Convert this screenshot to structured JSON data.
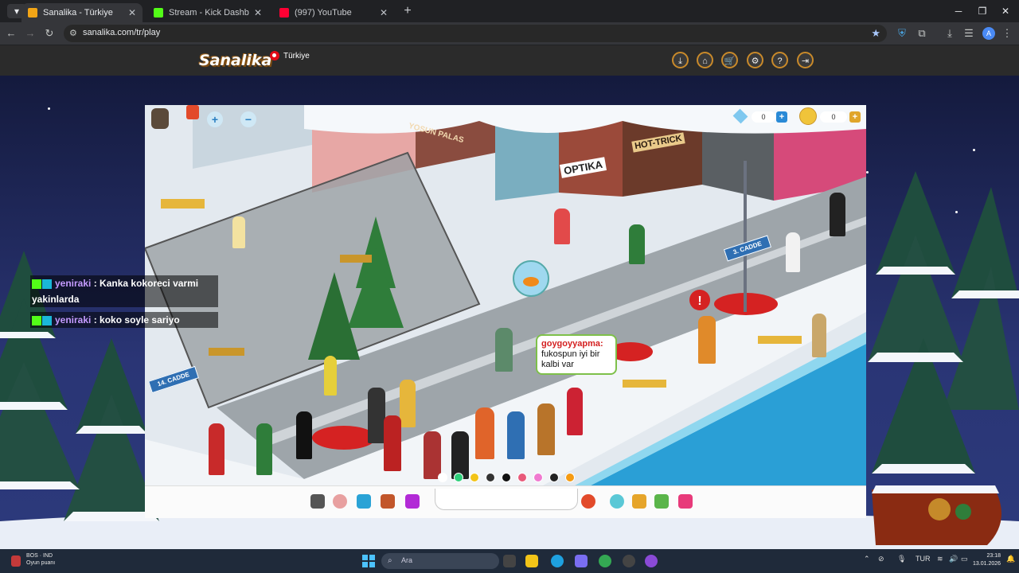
{
  "browser": {
    "tabs": [
      {
        "title": "Sanalika - Türkiye",
        "active": true,
        "favicon_color": "#f2a516"
      },
      {
        "title": "Stream - Kick Dashboard",
        "active": false,
        "favicon_color": "#53fc18"
      },
      {
        "title": "(997) YouTube",
        "active": false,
        "favicon_color": "#ff0033"
      }
    ],
    "url": "sanalika.com/tr/play",
    "profile_initial": "A"
  },
  "site": {
    "logo": "Sanalika",
    "country": "Türkiye",
    "nav_icons": [
      "download-icon",
      "home-icon",
      "cart-icon",
      "settings-icon",
      "help-icon",
      "logout-icon"
    ]
  },
  "game": {
    "diamonds": "0",
    "coins": "0",
    "signs": [
      "3. CADDE",
      "14. CADDE"
    ],
    "store_signs": [
      "YOSUN PALAS",
      "OPTIKA",
      "HOT-TRICK"
    ],
    "speech_bubble": {
      "user": "goygoyyapma:",
      "text": "fukospun iyi bir kalbi var"
    },
    "color_swatches": [
      "#ffffff",
      "#2ecf7a",
      "#f2c418",
      "#333333",
      "#111111",
      "#e85a7a",
      "#f07ad0",
      "#222222",
      "#f59b12"
    ]
  },
  "stream_chat": [
    {
      "user": "yeniraki",
      "message": ": Kanka kokoreci varmi yakinlarda"
    },
    {
      "user": "yeniraki",
      "message": ": koko soyle sariyo"
    }
  ],
  "taskbar": {
    "game_title": "BOS · IND",
    "game_subtitle": "Oyun puanı",
    "search_placeholder": "Ara",
    "language": "TUR",
    "time": "23:18",
    "date": "13.01.2026"
  }
}
